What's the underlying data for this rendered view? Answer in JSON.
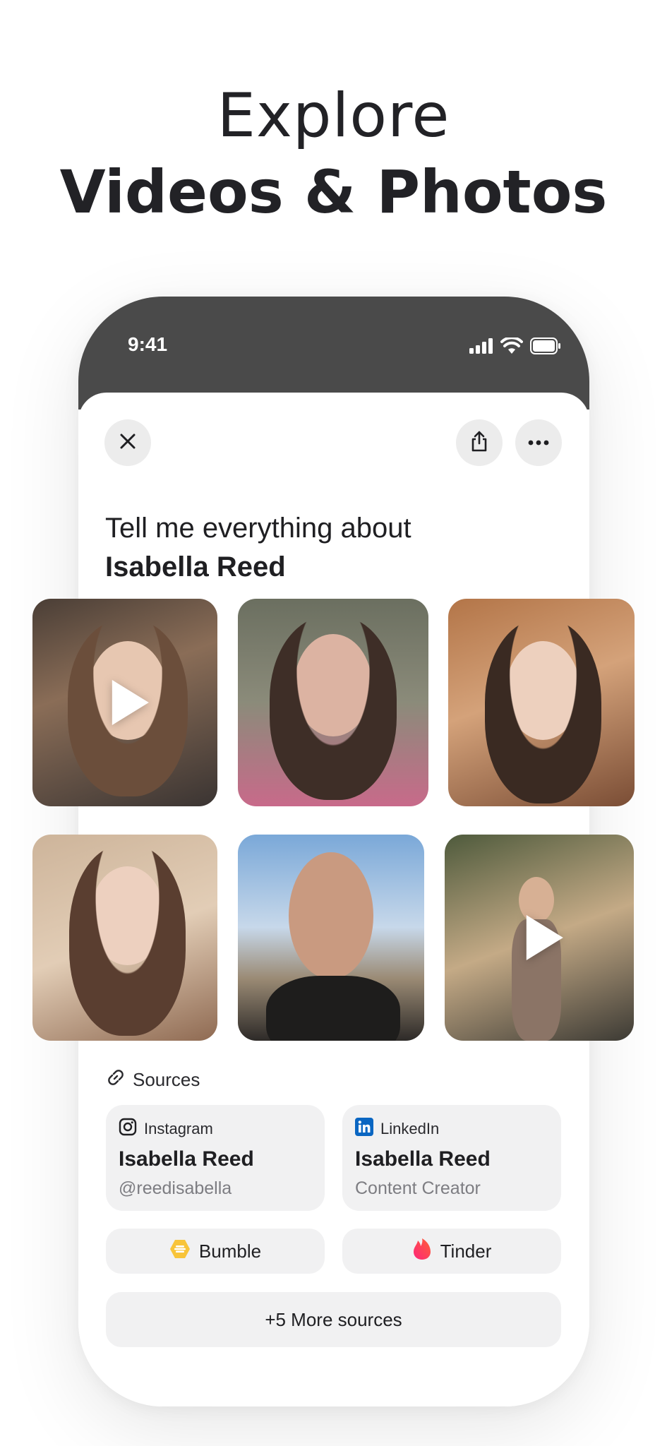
{
  "headline": {
    "light": "Explore",
    "bold": "Videos & Photos"
  },
  "statusbar": {
    "time": "9:41"
  },
  "toolbar": {
    "close_icon": "close-icon",
    "share_icon": "share-icon",
    "more_icon": "more-icon"
  },
  "prompt": {
    "line1": "Tell me everything about",
    "name": "Isabella Reed"
  },
  "media": [
    {
      "type": "video",
      "icon": "play-icon"
    },
    {
      "type": "photo"
    },
    {
      "type": "photo"
    },
    {
      "type": "photo"
    },
    {
      "type": "photo"
    },
    {
      "type": "video",
      "icon": "play-icon"
    }
  ],
  "sources": {
    "heading": "Sources",
    "cards": [
      {
        "platform": "Instagram",
        "name": "Isabella Reed",
        "sub": "@reedisabella"
      },
      {
        "platform": "LinkedIn",
        "name": "Isabella Reed",
        "sub": "Content Creator"
      }
    ],
    "pills": [
      {
        "label": "Bumble"
      },
      {
        "label": "Tinder"
      }
    ],
    "more": "+5 More sources"
  },
  "colors": {
    "statusbar": "#4a4a4a",
    "card_bg": "#f1f1f2",
    "linkedin": "#0a66c2",
    "bumble": "#f8c43a",
    "tinder": "#fd4b5a"
  }
}
